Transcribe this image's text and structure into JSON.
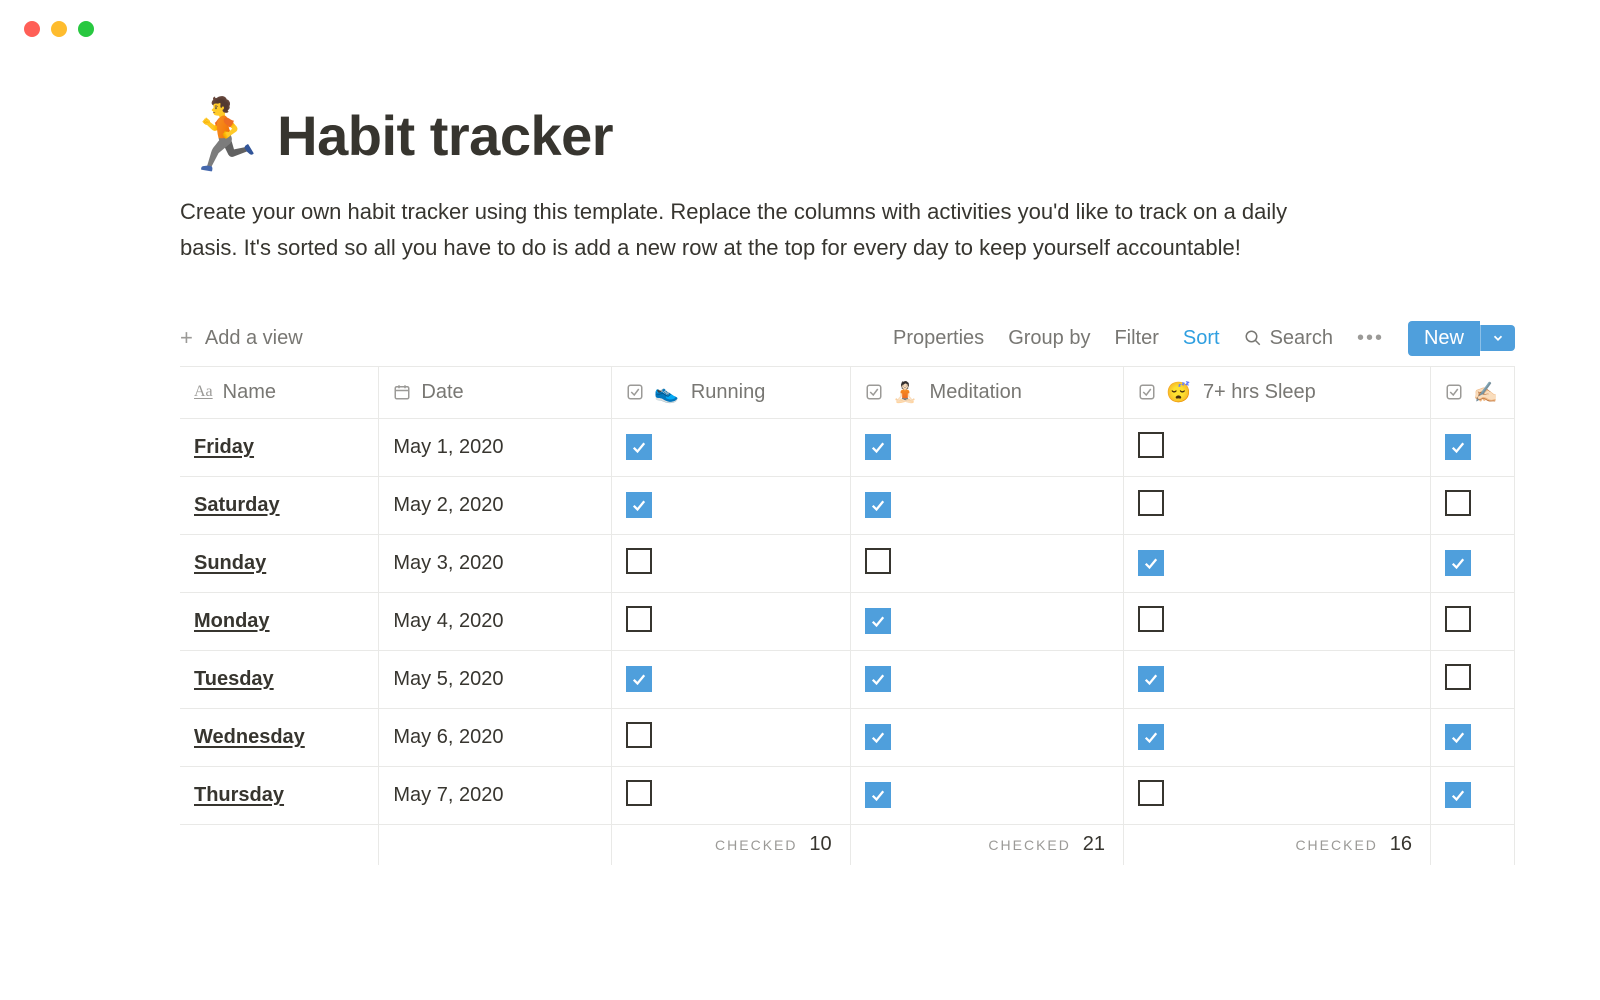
{
  "window": {
    "traffic_lights": [
      "red",
      "yellow",
      "green"
    ]
  },
  "header": {
    "icon": "🏃",
    "title": "Habit tracker",
    "description": "Create your own habit tracker using this template. Replace the columns with activities you'd like to track on a daily basis. It's sorted so all you have to do is add a new row at the top for every day to keep yourself accountable!"
  },
  "toolbar": {
    "add_view": "Add a view",
    "properties": "Properties",
    "group_by": "Group by",
    "filter": "Filter",
    "sort": "Sort",
    "search": "Search",
    "new_label": "New"
  },
  "columns": {
    "name": "Name",
    "date": "Date",
    "c1": {
      "emoji": "👟",
      "label": "Running"
    },
    "c2": {
      "emoji": "🧘🏻",
      "label": "Meditation"
    },
    "c3": {
      "emoji": "😴",
      "label": "7+ hrs Sleep"
    },
    "c4": {
      "emoji": "✍🏻",
      "label": ""
    }
  },
  "rows": [
    {
      "name": "Friday",
      "date": "May 1, 2020",
      "c1": true,
      "c2": true,
      "c3": false,
      "c4": true
    },
    {
      "name": "Saturday",
      "date": "May 2, 2020",
      "c1": true,
      "c2": true,
      "c3": false,
      "c4": false
    },
    {
      "name": "Sunday",
      "date": "May 3, 2020",
      "c1": false,
      "c2": false,
      "c3": true,
      "c4": true
    },
    {
      "name": "Monday",
      "date": "May 4, 2020",
      "c1": false,
      "c2": true,
      "c3": false,
      "c4": false
    },
    {
      "name": "Tuesday",
      "date": "May 5, 2020",
      "c1": true,
      "c2": true,
      "c3": true,
      "c4": false
    },
    {
      "name": "Wednesday",
      "date": "May 6, 2020",
      "c1": false,
      "c2": true,
      "c3": true,
      "c4": true
    },
    {
      "name": "Thursday",
      "date": "May 7, 2020",
      "c1": false,
      "c2": true,
      "c3": false,
      "c4": true
    }
  ],
  "footer": {
    "label": "CHECKED",
    "c1": "10",
    "c2": "21",
    "c3": "16"
  }
}
